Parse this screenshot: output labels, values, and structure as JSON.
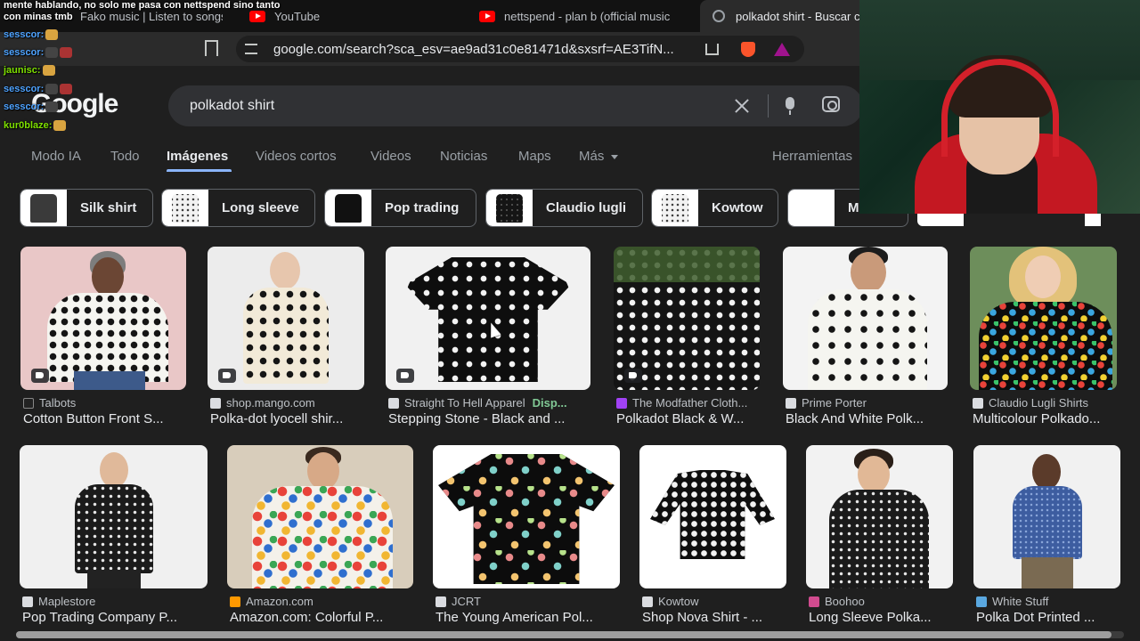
{
  "tabs": [
    {
      "label": "Fako music | Listen to songs"
    },
    {
      "label": "YouTube"
    },
    {
      "label": "nettspend - plan b (official music"
    },
    {
      "label": "polkadot shirt - Buscar con Google"
    }
  ],
  "address": {
    "url": "google.com/search?sca_esv=ae9ad31c0e81471d&sxsrf=AE3TifN..."
  },
  "search": {
    "logo": "Google",
    "query": "polkadot shirt"
  },
  "nav": {
    "items": [
      "Modo IA",
      "Todo",
      "Imágenes",
      "Videos cortos",
      "Videos",
      "Noticias",
      "Maps",
      "Más"
    ],
    "tools": "Herramientas"
  },
  "chips": [
    "Silk shirt",
    "Long sleeve",
    "Pop trading",
    "Claudio lugli",
    "Kowtow",
    "M"
  ],
  "results_row1": [
    {
      "source": "Talbots",
      "title": "Cotton Button Front S..."
    },
    {
      "source": "shop.mango.com",
      "title": "Polka-dot lyocell shir..."
    },
    {
      "source": "Straight To Hell Apparel",
      "extra": "Disp...",
      "title": "Stepping Stone - Black and ..."
    },
    {
      "source": "The Modfather Cloth...",
      "title": "Polkadot Black & W..."
    },
    {
      "source": "Prime Porter",
      "title": "Black And White Polk..."
    },
    {
      "source": "Claudio Lugli Shirts",
      "title": "Multicolour Polkado..."
    }
  ],
  "results_row2": [
    {
      "source": "Maplestore",
      "title": "Pop Trading Company P..."
    },
    {
      "source": "Amazon.com",
      "title": "Amazon.com: Colorful P..."
    },
    {
      "source": "JCRT",
      "title": "The Young American Pol..."
    },
    {
      "source": "Kowtow",
      "title": "Shop Nova Shirt - ..."
    },
    {
      "source": "Boohoo",
      "title": "Long Sleeve Polka..."
    },
    {
      "source": "White Stuff",
      "title": "Polka Dot Printed ..."
    }
  ],
  "chat": {
    "top_line_1": "mente hablando, no solo me pasa con nettspend sino tanto",
    "top_line_2": "con minas tmb",
    "messages": [
      {
        "user": "sesscor:"
      },
      {
        "user": "sesscor:"
      },
      {
        "user": "jaunisc:"
      },
      {
        "user": "sesscor:"
      },
      {
        "user": "sesscor:"
      },
      {
        "user": "kur0blaze:"
      }
    ]
  },
  "colors": {
    "accent": "#8ab4f8",
    "background": "#1f1f1f",
    "youtube_red": "#ff0000"
  }
}
